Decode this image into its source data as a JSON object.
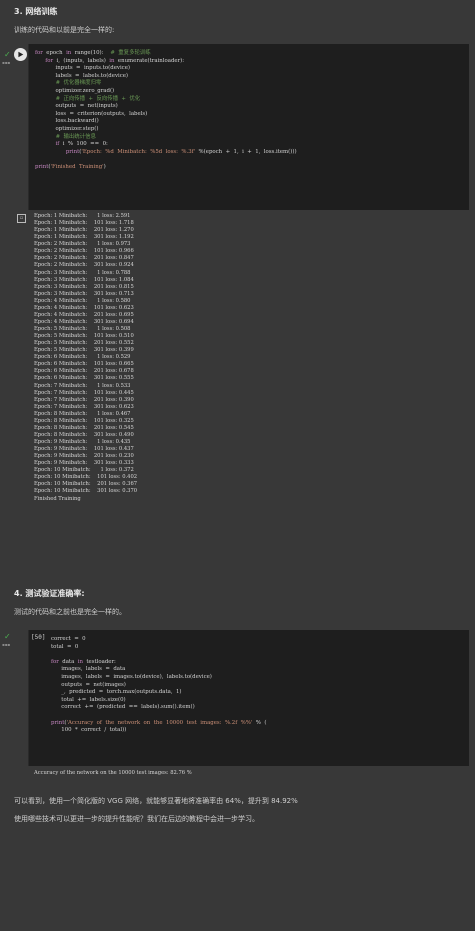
{
  "section3": {
    "heading": "3. 网络训练",
    "desc": "训练的代码和以前是完全一样的:"
  },
  "cell1": {
    "code_lines": [
      "for  epoch  in  range(10):    #  重复多轮训练",
      "      for  i,  (inputs,  labels)  in  enumerate(trainloader):",
      "            inputs  =  inputs.to(device)",
      "            labels  =  labels.to(device)",
      "            #  优化器梯度归零",
      "            optimizer.zero_grad()",
      "            #  正向传播  +  反向传播  +  优化",
      "            outputs  =  net(inputs)",
      "            loss  =  criterion(outputs,  labels)",
      "            loss.backward()",
      "            optimizer.step()",
      "            #  输出统计信息",
      "            if  i  %  100  ==  0:",
      "                  print('Epoch:  %d  Minibatch:  %5d  loss:  %.3f'  %(epoch  +  1,  i  +  1,  loss.item()))",
      "",
      "print('Finished  Training')"
    ],
    "output_lines": [
      "Epoch: 1 Minibatch:      1 loss: 2.591",
      "Epoch: 1 Minibatch:    101 loss: 1.718",
      "Epoch: 1 Minibatch:    201 loss: 1.270",
      "Epoch: 1 Minibatch:    301 loss: 1.192",
      "Epoch: 2 Minibatch:      1 loss: 0.973",
      "Epoch: 2 Minibatch:    101 loss: 0.966",
      "Epoch: 2 Minibatch:    201 loss: 0.847",
      "Epoch: 2 Minibatch:    301 loss: 0.924",
      "Epoch: 3 Minibatch:      1 loss: 0.788",
      "Epoch: 3 Minibatch:    101 loss: 1.084",
      "Epoch: 3 Minibatch:    201 loss: 0.815",
      "Epoch: 3 Minibatch:    301 loss: 0.713",
      "Epoch: 4 Minibatch:      1 loss: 0.580",
      "Epoch: 4 Minibatch:    101 loss: 0.623",
      "Epoch: 4 Minibatch:    201 loss: 0.695",
      "Epoch: 4 Minibatch:    301 loss: 0.694",
      "Epoch: 5 Minibatch:      1 loss: 0.508",
      "Epoch: 5 Minibatch:    101 loss: 0.510",
      "Epoch: 5 Minibatch:    201 loss: 0.552",
      "Epoch: 5 Minibatch:    301 loss: 0.399",
      "Epoch: 6 Minibatch:      1 loss: 0.529",
      "Epoch: 6 Minibatch:    101 loss: 0.665",
      "Epoch: 6 Minibatch:    201 loss: 0.678",
      "Epoch: 6 Minibatch:    301 loss: 0.555",
      "Epoch: 7 Minibatch:      1 loss: 0.533",
      "Epoch: 7 Minibatch:    101 loss: 0.445",
      "Epoch: 7 Minibatch:    201 loss: 0.390",
      "Epoch: 7 Minibatch:    301 loss: 0.623",
      "Epoch: 8 Minibatch:      1 loss: 0.467",
      "Epoch: 8 Minibatch:    101 loss: 0.325",
      "Epoch: 8 Minibatch:    201 loss: 0.545",
      "Epoch: 8 Minibatch:    301 loss: 0.490",
      "Epoch: 9 Minibatch:      1 loss: 0.435",
      "Epoch: 9 Minibatch:    101 loss: 0.437",
      "Epoch: 9 Minibatch:    201 loss: 0.230",
      "Epoch: 9 Minibatch:    301 loss: 0.333",
      "Epoch: 10 Minibatch:      1 loss: 0.372",
      "Epoch: 10 Minibatch:    101 loss: 0.402",
      "Epoch: 10 Minibatch:    201 loss: 0.367",
      "Epoch: 10 Minibatch:    301 loss: 0.370",
      "Finished Training"
    ]
  },
  "section4": {
    "heading": "4. 测试验证准确率:",
    "desc": "测试的代码和之前也是完全一样的。"
  },
  "cell2": {
    "exec_count": "[50]",
    "code_lines": [
      "correct  =  0",
      "total  =  0",
      "",
      "for  data  in  testloader:",
      "      images,  labels  =  data",
      "      images,  labels  =  images.to(device),  labels.to(device)",
      "      outputs  =  net(images)",
      "      _,  predicted  =  torch.max(outputs.data,  1)",
      "      total  +=  labels.size(0)",
      "      correct  +=  (predicted  ==  labels).sum().item()",
      "",
      "print('Accuracy  of  the  network  on  the  10000  test  images:  %.2f  %%'  %  (",
      "      100  *  correct  /  total))"
    ],
    "output": "Accuracy of the network on the 10000 test images: 82.76 %"
  },
  "closing": {
    "p1": "可以看到，使用一个简化版的 VGG 网络，就能够显著地将准确率由 64%，提升到 84.92%",
    "p2": "使用哪些技术可以更进一步的提升性能呢？我们在后边的教程中会进一步学习。"
  }
}
